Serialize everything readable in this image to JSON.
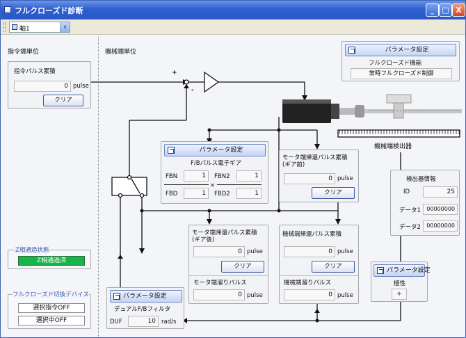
{
  "window": {
    "title": "フルクローズド診断",
    "min_glyph": "_",
    "max_glyph": "□",
    "close_glyph": "X"
  },
  "toolbar": {
    "axis": "軸1",
    "dropdown_glyph": "∨"
  },
  "left": {
    "section_title": "指令端単位",
    "pulse_panel": {
      "title": "指令パルス累積",
      "value": "0",
      "unit": "pulse",
      "clear": "クリア"
    },
    "z_phase": {
      "title": "Z相通過状態",
      "status": "Z相通過済"
    },
    "switch_device": {
      "title": "フルクローズド切換デバイス",
      "item1": "選択指令OFF",
      "item2": "選択中OFF"
    }
  },
  "main": {
    "section_title": "機械端単位",
    "plus": "+",
    "minus": "-",
    "param_label": "パラメータ設定",
    "fc_panel": {
      "title": "フルクローズド機能",
      "mode": "常時フルクローズド制御"
    },
    "encoder_label": "機械端検出器",
    "gear_panel": {
      "title": "F/Bパルス電子ギア",
      "fbn_label": "FBN",
      "fbn": "1",
      "fbn2_label": "FBN2",
      "fbn2": "1",
      "fbd_label": "FBD",
      "fbd": "1",
      "fbd2_label": "FBD2",
      "fbd2": "1",
      "times": "×"
    },
    "motor_before": {
      "title": "モータ端帰還パルス累積",
      "sub": "(ギア前)",
      "value": "0",
      "unit": "pulse",
      "clear": "クリア"
    },
    "detector": {
      "title": "検出器情報",
      "id_label": "ID",
      "id": "25",
      "d1_label": "データ1",
      "d1": "00000000",
      "d2_label": "データ2",
      "d2": "00000000"
    },
    "motor_after": {
      "title": "モータ端帰還パルス累積",
      "sub": "(ギア後)",
      "value": "0",
      "unit": "pulse",
      "clear": "クリア",
      "droop_title": "モータ端溜りパルス",
      "droop": "0",
      "droop_unit": "pulse"
    },
    "machine": {
      "title": "機械端帰還パルス累積",
      "value": "0",
      "unit": "pulse",
      "clear": "クリア",
      "droop_title": "機械端溜りパルス",
      "droop": "0",
      "droop_unit": "pulse"
    },
    "polarity": {
      "title": "極性",
      "value": "+"
    },
    "dual": {
      "title": "デュアルF/Bフィルタ",
      "label": "DUF",
      "value": "10",
      "unit": "rad/s"
    }
  }
}
